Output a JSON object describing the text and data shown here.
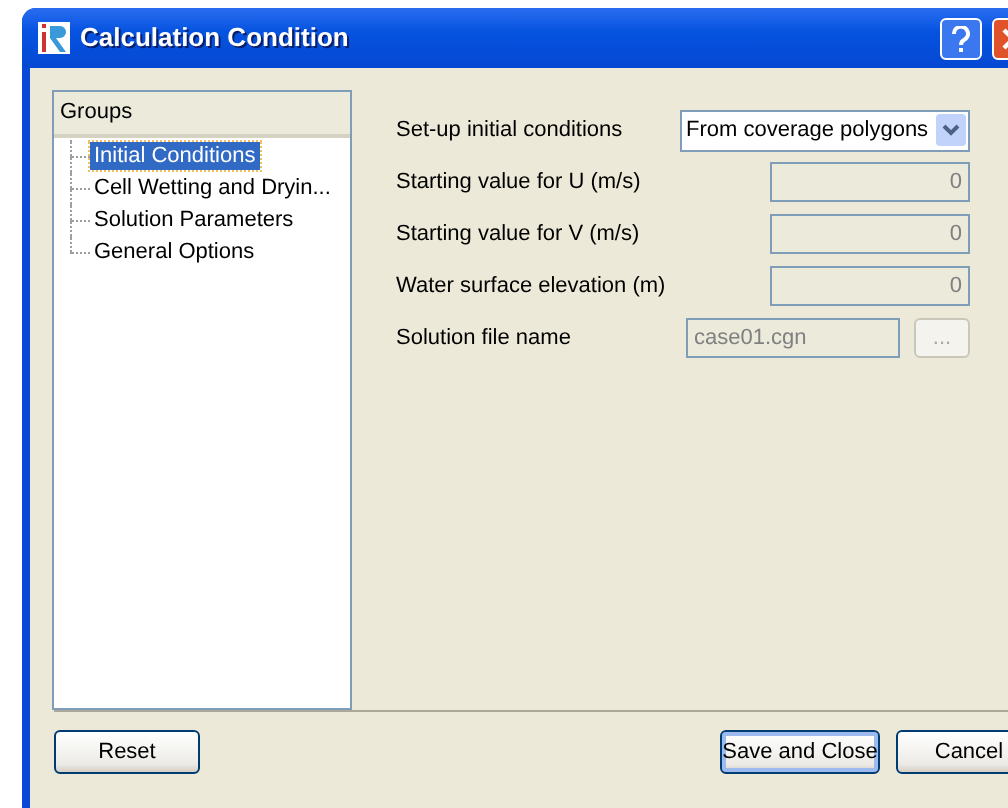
{
  "window": {
    "title": "Calculation Condition"
  },
  "groups": {
    "header": "Groups",
    "items": [
      {
        "label": "Initial Conditions",
        "selected": true
      },
      {
        "label": "Cell Wetting and Dryin...",
        "selected": false
      },
      {
        "label": "Solution Parameters",
        "selected": false
      },
      {
        "label": "General Options",
        "selected": false
      }
    ]
  },
  "fields": [
    {
      "kind": "select",
      "label": "Set-up initial conditions",
      "value": "From coverage polygons",
      "disabled": false
    },
    {
      "kind": "number",
      "label": "Starting value for U (m/s)",
      "value": "0",
      "disabled": true
    },
    {
      "kind": "number",
      "label": "Starting value for V (m/s)",
      "value": "0",
      "disabled": true
    },
    {
      "kind": "number",
      "label": "Water surface elevation (m)",
      "value": "0",
      "disabled": true
    },
    {
      "kind": "file",
      "label": "Solution file name",
      "value": "case01.cgn",
      "button": "...",
      "disabled": true
    }
  ],
  "buttons": {
    "reset": "Reset",
    "save": "Save and Close",
    "cancel": "Cancel"
  }
}
